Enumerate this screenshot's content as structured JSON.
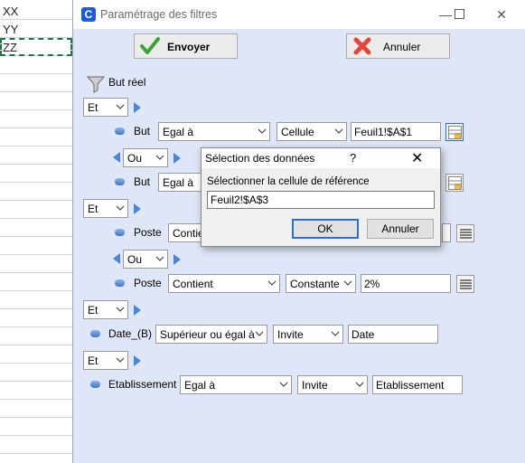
{
  "sheet": {
    "cells": [
      "XX",
      "YY",
      "ZZ"
    ]
  },
  "window": {
    "title": "Paramétrage des filtres",
    "minimize": "—",
    "maximize": "☐",
    "close": "✕",
    "logo": "C"
  },
  "actions": {
    "send": "Envoyer",
    "cancel": "Annuler"
  },
  "filters": {
    "root_label": "But réel",
    "groups": [
      {
        "logic": "Et",
        "items": [
          {
            "field": "But",
            "operator": "Egal à",
            "type": "Cellule",
            "value": "Feuil1!$A$1"
          },
          {
            "field": "But",
            "operator": "Egal à",
            "type": "",
            "value": ""
          }
        ],
        "inner_logic": "Ou"
      },
      {
        "logic": "Et",
        "items": [
          {
            "field": "Poste",
            "operator": "Contient",
            "type": "",
            "value": ""
          },
          {
            "field": "Poste",
            "operator": "Contient",
            "type": "Constante",
            "value": "2%"
          }
        ],
        "inner_logic": "Ou"
      },
      {
        "logic": "Et",
        "items": [
          {
            "field": "Date_(B)",
            "operator": "Supérieur ou égal à",
            "type": "Invite",
            "value": "Date"
          }
        ]
      },
      {
        "logic": "Et",
        "items": [
          {
            "field": "Etablissement",
            "operator": "Egal à",
            "type": "Invite",
            "value": "Etablissement"
          }
        ]
      }
    ]
  },
  "subdialog": {
    "title": "Sélection des données",
    "help": "?",
    "close": "✕",
    "prompt": "Sélectionner la cellule de référence",
    "value": "Feuil2!$A$3",
    "ok": "OK",
    "cancel": "Annuler"
  },
  "colors": {
    "accent": "#2a6fd3",
    "panel": "#dfe6f7",
    "arrow": "#4a86d8"
  }
}
